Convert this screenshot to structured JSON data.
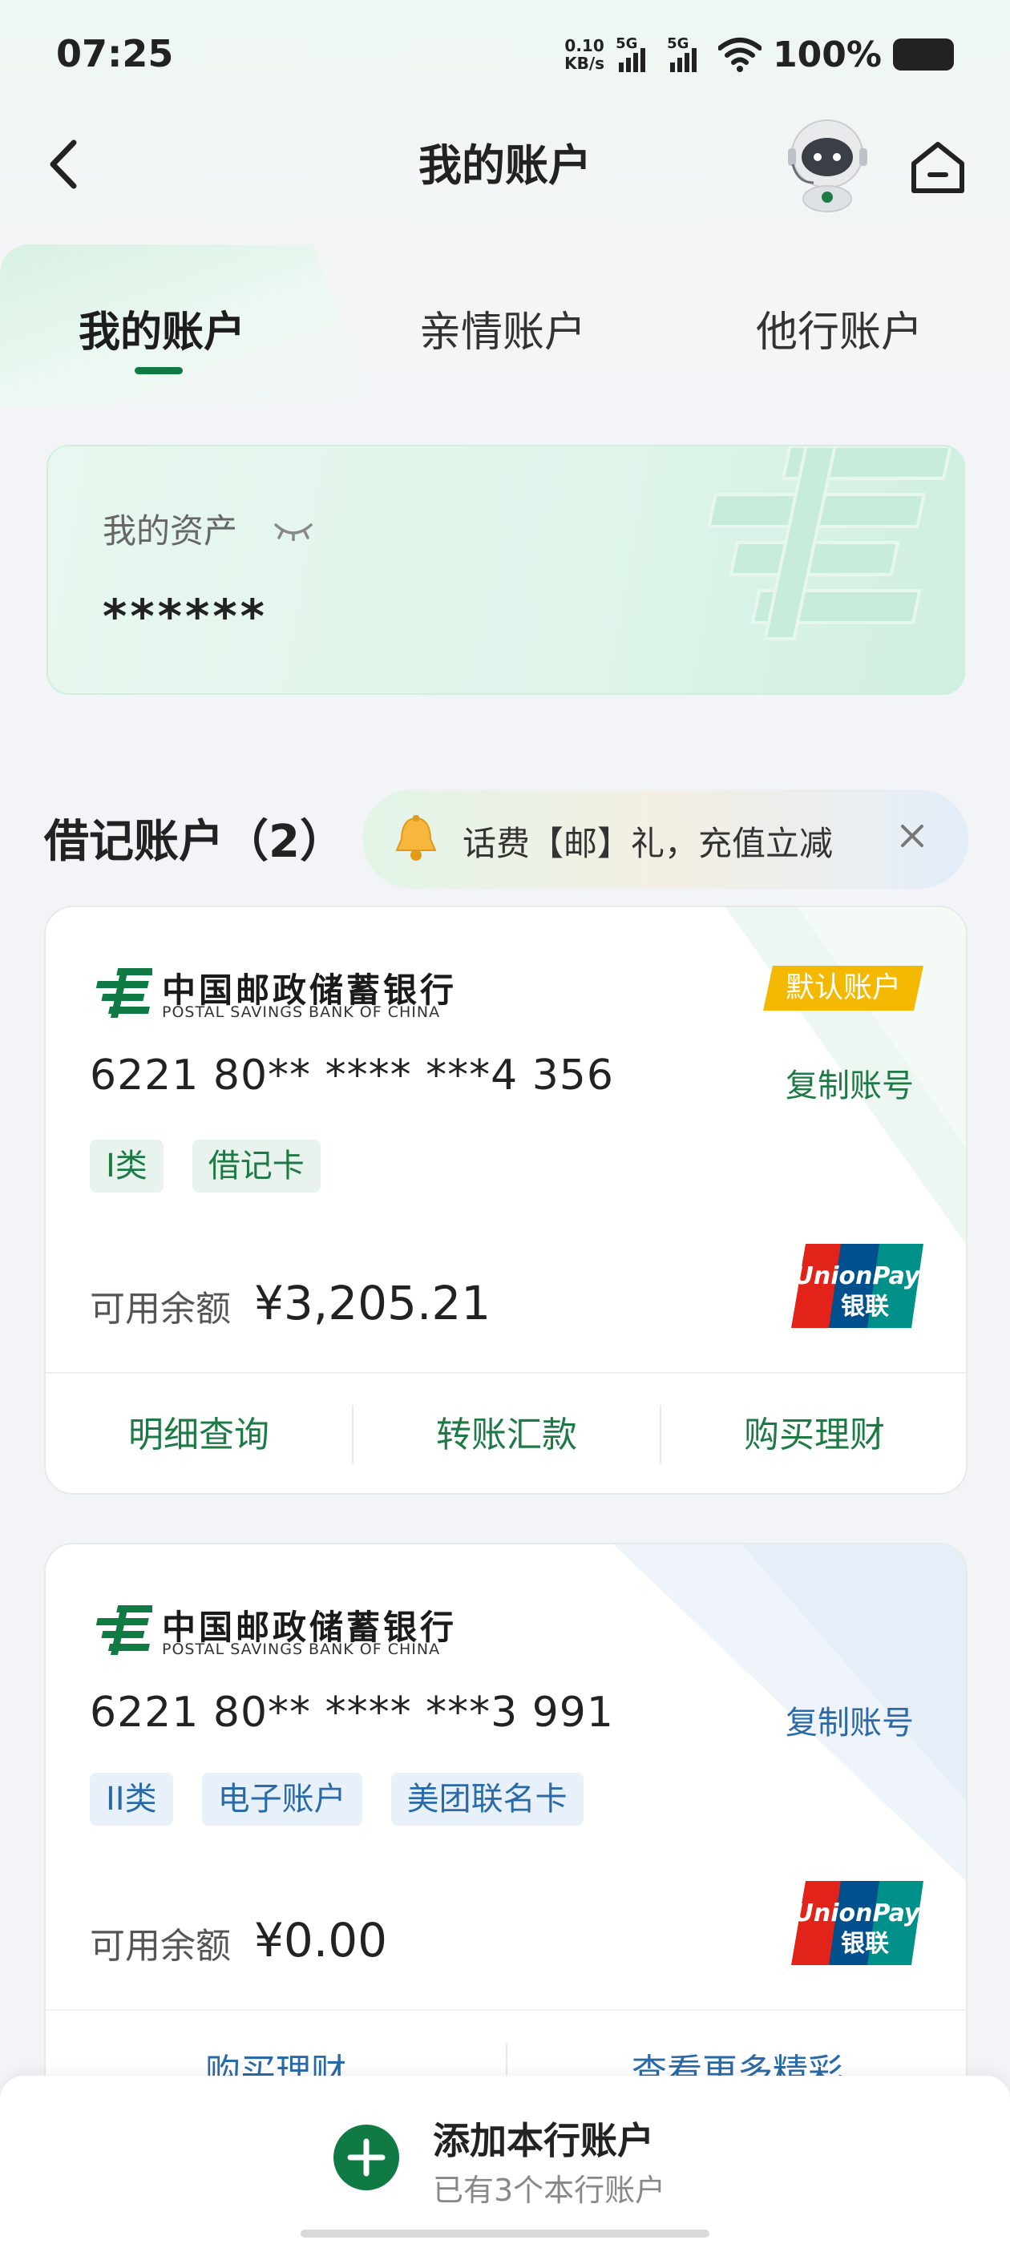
{
  "status_bar": {
    "time": "07:25",
    "net_speed_value": "0.10",
    "net_speed_unit": "KB/s",
    "signal1_label": "5G",
    "signal2_label": "5G",
    "battery_percent": "100%"
  },
  "header": {
    "title": "我的账户"
  },
  "tabs": [
    {
      "label": "我的账户",
      "active": true
    },
    {
      "label": "亲情账户",
      "active": false
    },
    {
      "label": "他行账户",
      "active": false
    }
  ],
  "assets": {
    "label": "我的资产",
    "value": "******"
  },
  "section": {
    "title": "借记账户（2）"
  },
  "promo": {
    "text": "话费【邮】礼，充值立减"
  },
  "bank": {
    "name_cn": "中国邮政储蓄银行",
    "name_en": "POSTAL SAVINGS BANK OF CHINA"
  },
  "accounts": [
    {
      "default_badge": "默认账户",
      "card_number": "6221 80** **** ***4 356",
      "copy_label": "复制账号",
      "tags": [
        "I类",
        "借记卡"
      ],
      "balance_label": "可用余额",
      "balance": "¥3,205.21",
      "actions": [
        "明细查询",
        "转账汇款",
        "购买理财"
      ]
    },
    {
      "card_number": "6221 80** **** ***3 991",
      "copy_label": "复制账号",
      "tags": [
        "II类",
        "电子账户",
        "美团联名卡"
      ],
      "balance_label": "可用余额",
      "balance": "¥0.00",
      "actions": [
        "购买理财",
        "查看更多精彩"
      ]
    }
  ],
  "bottom": {
    "add_title": "添加本行账户",
    "add_subtitle": "已有3个本行账户"
  },
  "colors": {
    "brand_green": "#0f7a43",
    "link_green": "#1e7a45",
    "link_blue": "#2a6aa8",
    "badge_yellow": "#f5b800"
  }
}
